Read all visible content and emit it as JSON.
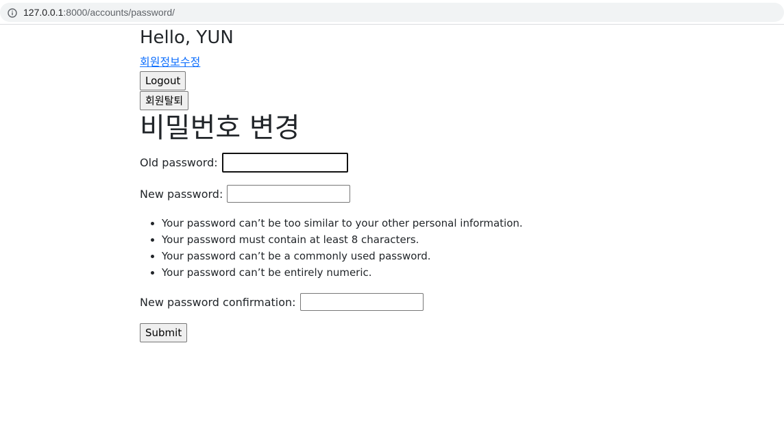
{
  "browser": {
    "url_host": "127.0.0.1",
    "url_rest": ":8000/accounts/password/"
  },
  "header": {
    "greeting": "Hello, YUN",
    "edit_profile_link": "회원정보수정",
    "logout_button": "Logout",
    "withdraw_button": "회원탈퇴"
  },
  "form": {
    "title": "비밀번호 변경",
    "old_password_label": "Old password:",
    "new_password_label": "New password:",
    "help_texts": [
      "Your password can’t be too similar to your other personal information.",
      "Your password must contain at least 8 characters.",
      "Your password can’t be a commonly used password.",
      "Your password can’t be entirely numeric."
    ],
    "confirm_label": "New password confirmation:",
    "submit_button": "Submit"
  },
  "colors": {
    "link": "#0d6efd",
    "text": "#212529",
    "button_bg": "#efefef"
  },
  "icons": {
    "address_bar": "info-icon"
  }
}
